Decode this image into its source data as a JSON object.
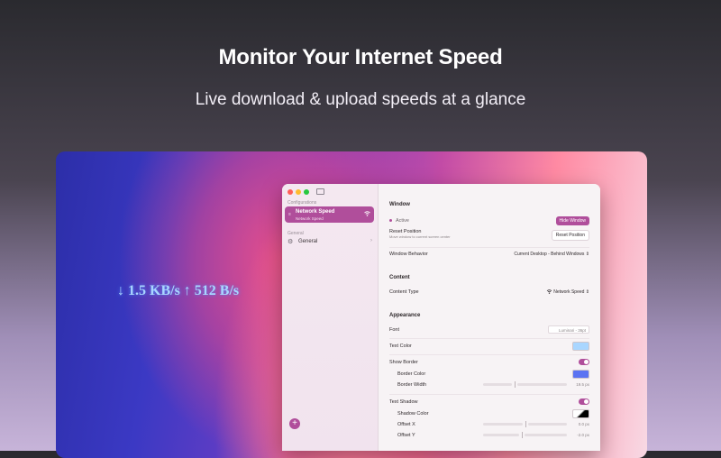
{
  "hero": {
    "title": "Monitor Your Internet Speed",
    "subtitle": "Live download & upload speeds at a glance"
  },
  "desktop_overlay": {
    "speed_text": "↓ 1.5 KB/s ↑ 512 B/s"
  },
  "sidebar": {
    "section_configurations": "Configurations",
    "selected_item": {
      "title": "Network Speed",
      "subtitle": "Network Speed"
    },
    "section_general": "General",
    "general_item": "General",
    "add_label": "+"
  },
  "window_section": {
    "header": "Window",
    "active_label": "Active",
    "hide_button": "Hide Window",
    "reset_label": "Reset Position",
    "reset_note": "Move window to current screen center",
    "reset_button": "Reset Position",
    "behavior_label": "Window Behavior",
    "behavior_value": "Current Desktop - Behind Windows ⇕"
  },
  "content_section": {
    "header": "Content",
    "type_label": "Content Type",
    "type_value": "Network Speed ⇕"
  },
  "appearance_section": {
    "header": "Appearance",
    "font_label": "Font",
    "font_value": "Luminari - 36pt",
    "text_color_label": "Text Color",
    "text_color": "#a9d6ff",
    "show_border_label": "Show Border",
    "show_border_on": true,
    "border_color_label": "Border Color",
    "border_color": "#5b73f2",
    "border_width_label": "Border Width",
    "border_width_value": "19.5 px",
    "text_shadow_label": "Text Shadow",
    "text_shadow_on": true,
    "shadow_color_label": "Shadow Color",
    "offset_x_label": "Offset X",
    "offset_x_value": "0.0 px",
    "offset_y_label": "Offset Y",
    "offset_y_value": "-2.0 px"
  },
  "colors": {
    "accent": "#b04e9b"
  }
}
